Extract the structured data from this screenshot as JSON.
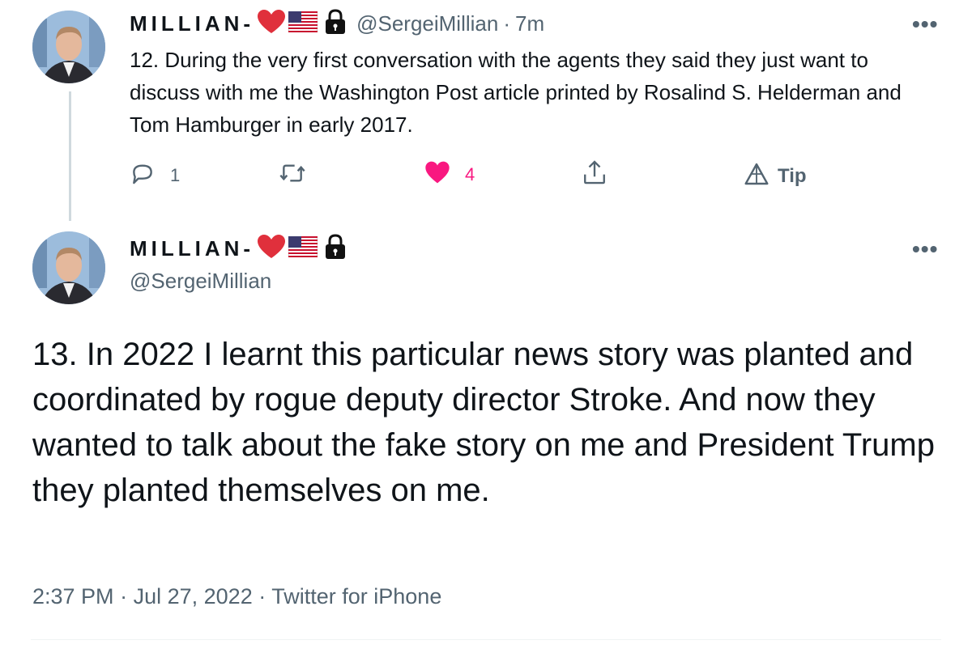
{
  "tweet1": {
    "display_name": "MILLIAN-",
    "handle": "@SergeiMillian",
    "separator": "·",
    "time_ago": "7m",
    "text": "12. During the very first conversation with the agents they said they just want to discuss with me the Washington Post article printed by Rosalind S. Helderman and Tom Hamburger in early 2017.",
    "more_label": "•••",
    "reply_count": "1",
    "retweet_count": "",
    "like_count": "4",
    "tip_label": "Tip",
    "liked": true
  },
  "tweet2": {
    "display_name": "MILLIAN-",
    "handle": "@SergeiMillian",
    "more_label": "•••",
    "text": "13. In 2022 I learnt this particular news story was planted and coordinated by rogue deputy director Stroke. And now they wanted to talk about the fake story on me and President Trump they planted themselves on me.",
    "time": "2:37 PM",
    "date": "Jul 27, 2022",
    "source": "Twitter for iPhone",
    "separator": "·"
  },
  "icons": {
    "heart_emoji": "red-heart-icon",
    "flag_emoji": "us-flag-icon",
    "lock_emoji": "lock-icon",
    "reply": "reply-icon",
    "retweet": "retweet-icon",
    "like": "heart-icon",
    "share": "share-icon",
    "tip": "tip-icon"
  },
  "colors": {
    "text": "#0f1419",
    "secondary": "#536471",
    "like": "#f91880",
    "heart_emoji": "#e0303c",
    "thread_line": "#cfd9de"
  }
}
